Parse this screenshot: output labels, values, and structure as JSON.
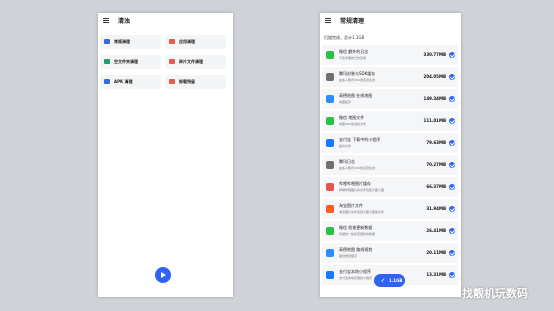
{
  "left": {
    "title": "清浊",
    "cards": [
      {
        "label": "常规清理",
        "icon": "clean-icon",
        "color": "#3a66f0"
      },
      {
        "label": "应用清理",
        "icon": "app-clean-icon",
        "color": "#e85a4f"
      },
      {
        "label": "空文件夹清理",
        "icon": "folder-icon",
        "color": "#1e9e6a"
      },
      {
        "label": "碎片文件清理",
        "icon": "fragment-icon",
        "color": "#e85a4f"
      },
      {
        "label": "APK 清理",
        "icon": "android-icon",
        "color": "#3a66f0"
      },
      {
        "label": "卸载残留",
        "icon": "uninstall-icon",
        "color": "#e85a4f"
      }
    ],
    "fab_icon": "play-icon"
  },
  "right": {
    "title": "常规清理",
    "scan_result": "扫描完成，总计1.1GB",
    "items": [
      {
        "name": "微信 额外的日志",
        "desc": "不含手機的日志目录",
        "size": "330.77MB",
        "icon": "wechat-icon",
        "color": "#2dc149"
      },
      {
        "name": "腾讯封装与SDK缓存",
        "desc": "由多人腾讯SDK的应用生成",
        "size": "204.05MB",
        "icon": "folder-icon",
        "color": "#6f6f6f"
      },
      {
        "name": "高德地图 在线地图",
        "desc": "地图缓存",
        "size": "149.34MB",
        "icon": "amap-icon",
        "color": "#2f8cff"
      },
      {
        "name": "微信 地图文件",
        "desc": "地图SDK加载的文件",
        "size": "111.01MB",
        "icon": "wechat-icon",
        "color": "#2dc149"
      },
      {
        "name": "支付宝 下载中的小程序",
        "desc": "临时文件",
        "size": "79.63MB",
        "icon": "alipay-icon",
        "color": "#1677ff"
      },
      {
        "name": "腾讯日志",
        "desc": "由多人腾讯SDK的应用生成",
        "size": "70.27MB",
        "icon": "folder-icon",
        "color": "#6f6f6f"
      },
      {
        "name": "哔哩哔哩图片缓存",
        "desc": "哔哩哔哩图片将文件包括大图小图",
        "size": "66.37MB",
        "icon": "bilibili-icon",
        "color": "#e2574c"
      },
      {
        "name": "淘宝图片文件",
        "desc": "淘宝图片文件包括大图小图等文件",
        "size": "31.94MB",
        "icon": "taobao-icon",
        "color": "#ff5a1f"
      },
      {
        "name": "微信 检查更新数据",
        "desc": "存储的一些检查更新的数据",
        "size": "26.41MB",
        "icon": "wechat-icon",
        "color": "#2dc149"
      },
      {
        "name": "高德地图 路线规划",
        "desc": "路线规划缓存",
        "size": "20.11MB",
        "icon": "amap-icon",
        "color": "#2f8cff"
      },
      {
        "name": "支付宝本地小程序",
        "desc": "支付宝本地存储的小程序",
        "size": "13.31MB",
        "icon": "alipay-icon",
        "color": "#1677ff"
      }
    ],
    "clean_button": "1.1GB",
    "clean_icon": "broom-icon"
  },
  "watermark": "找靓机玩数码"
}
